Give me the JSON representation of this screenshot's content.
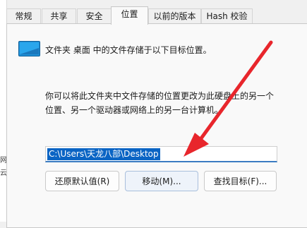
{
  "tabs": [
    {
      "label": "常规"
    },
    {
      "label": "共享"
    },
    {
      "label": "安全"
    },
    {
      "label": "位置"
    },
    {
      "label": "以前的版本"
    },
    {
      "label": "Hash 校验"
    }
  ],
  "active_tab": "位置",
  "location": {
    "description": "文件夹 桌面 中的文件存储于以下目标位置。",
    "explain_line1": "你可以将此文件夹中文件存储的位置更改为此硬盘上的另一个",
    "explain_line2": "位置、另一个驱动器或网络上的另一台计算机。",
    "path_value": "C:\\Users\\天龙八部\\Desktop"
  },
  "buttons": {
    "restore_default": "还原默认值(R)",
    "move": "移动(M)...",
    "find_target": "查找目标(F)..."
  },
  "background_fragments": [
    "网",
    "云"
  ],
  "colors": {
    "annotation_arrow": "#e8262c",
    "selection": "#0a64c4",
    "folder_icon": "#1f8fd6"
  },
  "icons": {
    "location_folder": "desktop-folder-icon"
  }
}
